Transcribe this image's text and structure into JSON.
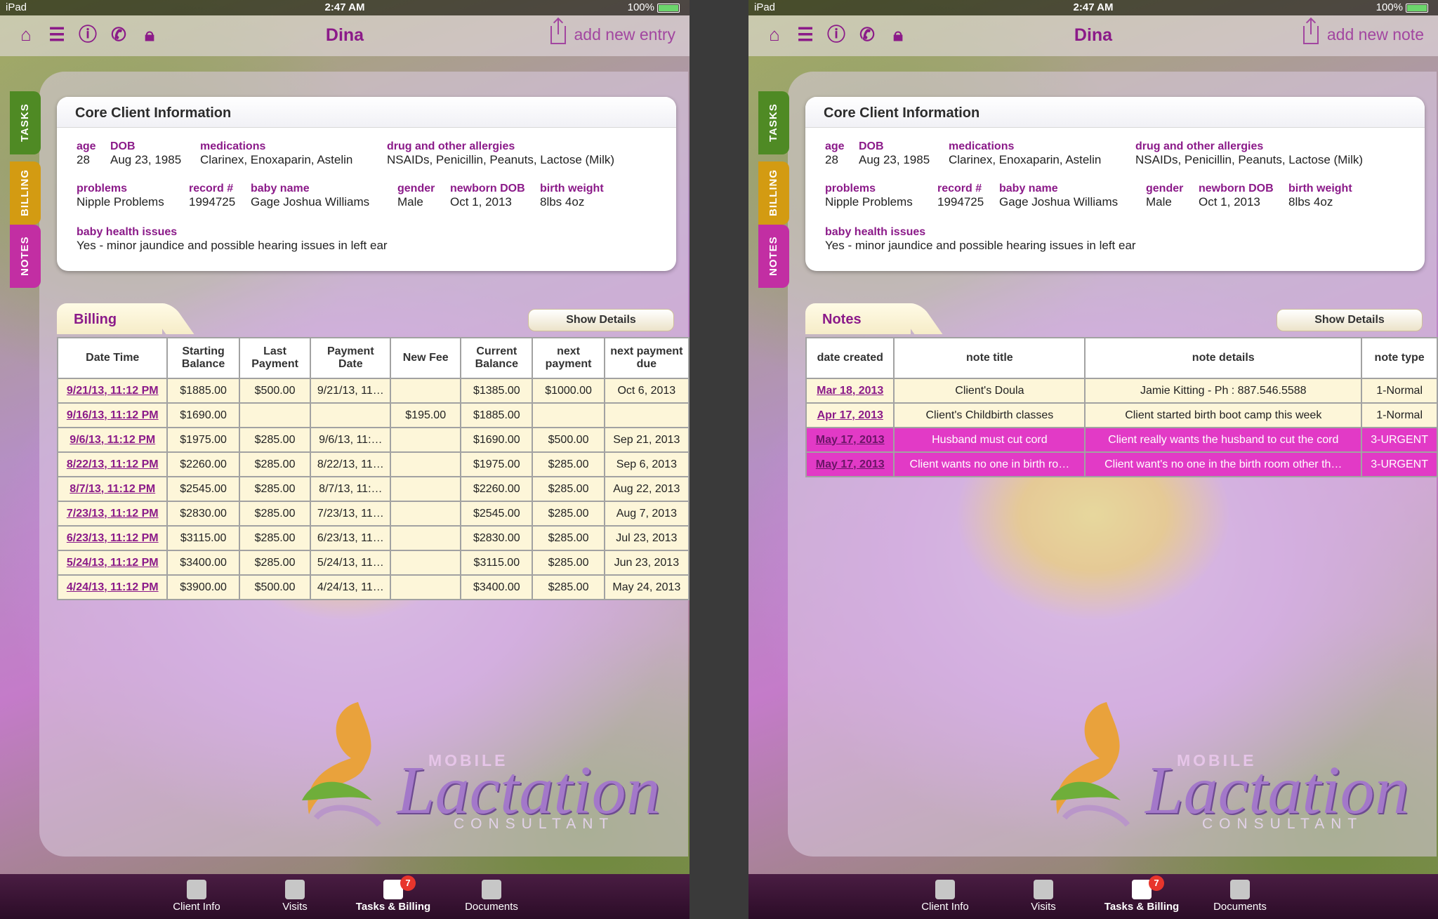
{
  "status": {
    "carrier": "iPad",
    "time": "2:47 AM",
    "battery": "100%"
  },
  "tabbar": {
    "client_info": "Client Info",
    "visits": "Visits",
    "tasks_billing": "Tasks & Billing",
    "documents": "Documents",
    "badge": "7"
  },
  "sidetabs": {
    "tasks": "TASKS",
    "billing": "BILLING",
    "notes": "NOTES"
  },
  "logo": {
    "mobile": "MOBILE",
    "lactation": "Lactation",
    "consultant": "CONSULTANT"
  },
  "client": {
    "name": "Dina",
    "card_title": "Core Client Information",
    "age_label": "age",
    "age": "28",
    "dob_label": "DOB",
    "dob": "Aug 23, 1985",
    "medications_label": "medications",
    "medications": "Clarinex, Enoxaparin, Astelin",
    "allergies_label": "drug and other allergies",
    "allergies": "NSAIDs, Penicillin, Peanuts, Lactose (Milk)",
    "problems_label": "problems",
    "problems": "Nipple Problems",
    "record_label": "record #",
    "record": "1994725",
    "baby_name_label": "baby name",
    "baby_name": "Gage Joshua Williams",
    "gender_label": "gender",
    "gender": "Male",
    "newborn_dob_label": "newborn DOB",
    "newborn_dob": "Oct 1, 2013",
    "birth_weight_label": "birth weight",
    "birth_weight": "8lbs 4oz",
    "baby_health_label": "baby health issues",
    "baby_health": "Yes - minor jaundice and possible hearing issues in left ear"
  },
  "left": {
    "action": "add new entry",
    "section": "Billing",
    "show_details": "Show Details",
    "headers": [
      "Date Time",
      "Starting Balance",
      "Last Payment",
      "Payment Date",
      "New Fee",
      "Current Balance",
      "next payment",
      "next payment due"
    ],
    "rows": [
      [
        "9/21/13, 11:12 PM",
        "$1885.00",
        "$500.00",
        "9/21/13, 11…",
        "",
        "$1385.00",
        "$1000.00",
        "Oct 6, 2013"
      ],
      [
        "9/16/13, 11:12 PM",
        "$1690.00",
        "",
        "",
        "$195.00",
        "$1885.00",
        "",
        ""
      ],
      [
        "9/6/13, 11:12 PM",
        "$1975.00",
        "$285.00",
        "9/6/13, 11:…",
        "",
        "$1690.00",
        "$500.00",
        "Sep 21, 2013"
      ],
      [
        "8/22/13, 11:12 PM",
        "$2260.00",
        "$285.00",
        "8/22/13, 11…",
        "",
        "$1975.00",
        "$285.00",
        "Sep 6, 2013"
      ],
      [
        "8/7/13, 11:12 PM",
        "$2545.00",
        "$285.00",
        "8/7/13, 11:…",
        "",
        "$2260.00",
        "$285.00",
        "Aug 22, 2013"
      ],
      [
        "7/23/13, 11:12 PM",
        "$2830.00",
        "$285.00",
        "7/23/13, 11…",
        "",
        "$2545.00",
        "$285.00",
        "Aug 7, 2013"
      ],
      [
        "6/23/13, 11:12 PM",
        "$3115.00",
        "$285.00",
        "6/23/13, 11…",
        "",
        "$2830.00",
        "$285.00",
        "Jul 23, 2013"
      ],
      [
        "5/24/13, 11:12 PM",
        "$3400.00",
        "$285.00",
        "5/24/13, 11…",
        "",
        "$3115.00",
        "$285.00",
        "Jun 23, 2013"
      ],
      [
        "4/24/13, 11:12 PM",
        "$3900.00",
        "$500.00",
        "4/24/13, 11…",
        "",
        "$3400.00",
        "$285.00",
        "May 24, 2013"
      ]
    ]
  },
  "right": {
    "action": "add new note",
    "section": "Notes",
    "show_details": "Show Details",
    "headers": [
      "date created",
      "note title",
      "note details",
      "note type"
    ],
    "rows": [
      {
        "cells": [
          "Mar 18, 2013",
          "Client's Doula",
          "Jamie Kitting - Ph : 887.546.5588",
          "1-Normal"
        ],
        "urgent": false
      },
      {
        "cells": [
          "Apr 17, 2013",
          "Client's Childbirth classes",
          "Client started birth boot camp this week",
          "1-Normal"
        ],
        "urgent": false
      },
      {
        "cells": [
          "May 17, 2013",
          "Husband must cut cord",
          "Client really wants the husband to cut the cord",
          "3-URGENT"
        ],
        "urgent": true
      },
      {
        "cells": [
          "May 17, 2013",
          "Client wants no one in birth ro…",
          "Client want's no one in the birth room other th…",
          "3-URGENT"
        ],
        "urgent": true
      }
    ]
  },
  "colors": {
    "accent": "#8b1a89",
    "urgent": "#e23ac6",
    "table_bg": "#fdf6d9"
  }
}
